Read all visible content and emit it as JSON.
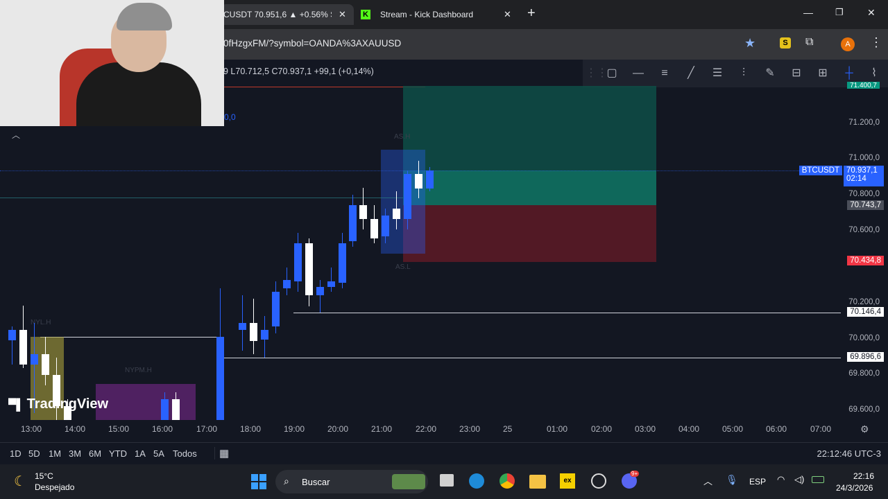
{
  "browser": {
    "tabs": [
      {
        "label": "CUSDT 70.951,6 ▲ +0.56% Si",
        "active": true
      },
      {
        "label": "Stream - Kick Dashboard",
        "active": false
      }
    ],
    "url": "0fHzgxFM/?symbol=OANDA%3AXAUUSD",
    "profile_initial": "A"
  },
  "chart": {
    "ohlc_text": "9  L70.712,5  C70.937,1  +99,1 (+0,14%)",
    "top_left_value": "0,0",
    "symbol_tag": "BTCUSDT",
    "current_price": "70.937,1",
    "countdown": "02:14",
    "price_axis": [
      "71.200,0",
      "71.000,0",
      "70.800,0",
      "70.600,0",
      "70.200,0",
      "70.000,0",
      "69.800,0",
      "69.600,0"
    ],
    "top_partial_label": "71.400,7",
    "tag_gray": "70.743,7",
    "tag_red": "70.434,8",
    "line_label_1": "70.146,4",
    "line_label_2": "69.896,6",
    "time_axis": [
      "13:00",
      "14:00",
      "15:00",
      "16:00",
      "17:00",
      "18:00",
      "19:00",
      "20:00",
      "21:00",
      "22:00",
      "23:00",
      "25",
      "01:00",
      "02:00",
      "03:00",
      "04:00",
      "05:00",
      "06:00",
      "07:00"
    ],
    "session_labels": {
      "nyl": "NYL.H",
      "nypm": "NYPM.H",
      "as_h": "AS.H",
      "as_l": "AS.L"
    },
    "watermark": "TradingView",
    "colors": {
      "bull": "#ffffff",
      "bear": "#2962ff",
      "long_zone": "#0e6b5c",
      "short_zone": "#6b1e2a",
      "tag_blue": "#2962ff",
      "tag_red": "#f23645"
    }
  },
  "bottom": {
    "ranges": [
      "1D",
      "5D",
      "1M",
      "3M",
      "6M",
      "YTD",
      "1A",
      "5A",
      "Todos"
    ],
    "clock": "22:12:46 UTC-3"
  },
  "taskbar": {
    "weather_temp": "15°C",
    "weather_desc": "Despejado",
    "search_placeholder": "Buscar",
    "lang": "ESP",
    "time": "22:16",
    "date": "24/3/2026",
    "discord_badge": "9+"
  }
}
